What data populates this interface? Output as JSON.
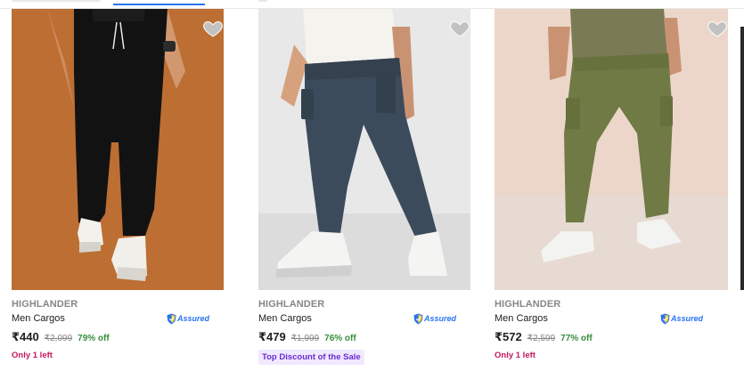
{
  "products": [
    {
      "brand": "HIGHLANDER",
      "title": "Men Cargos",
      "assured": "Assured",
      "price": "₹440",
      "mrp": "₹2,099",
      "discount": "79% off",
      "note": "Only 1 left",
      "wishlist_icon": "heart-icon"
    },
    {
      "brand": "HIGHLANDER",
      "title": "Men Cargos",
      "assured": "Assured",
      "price": "₹479",
      "mrp": "₹1,999",
      "discount": "76% off",
      "note": "Top Discount of the Sale",
      "wishlist_icon": "heart-icon"
    },
    {
      "brand": "HIGHLANDER",
      "title": "Men Cargos",
      "assured": "Assured",
      "price": "₹572",
      "mrp": "₹2,599",
      "discount": "77% off",
      "note": "Only 1 left",
      "wishlist_icon": "heart-icon"
    }
  ],
  "colors": {
    "discount": "#388e3c",
    "assured": "#2874f0",
    "low_stock": "#c2185b",
    "tag_text": "#6b2bd4",
    "tag_bg": "#f1e9ff"
  }
}
